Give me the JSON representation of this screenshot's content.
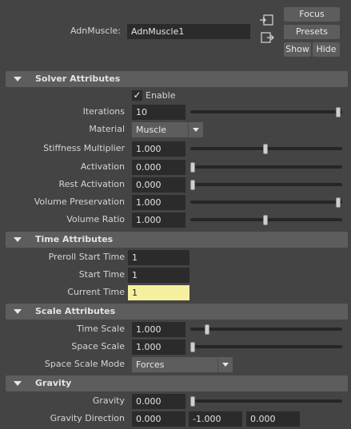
{
  "header": {
    "node_label": "AdnMuscle:",
    "node_value": "AdnMuscle1",
    "focus_label": "Focus",
    "presets_label": "Presets",
    "show_label": "Show",
    "hide_label": "Hide",
    "input_icon": "connection-in-icon",
    "output_icon": "connection-out-icon"
  },
  "solver": {
    "title": "Solver Attributes",
    "enable_label": "Enable",
    "enable_checked": true,
    "iterations": {
      "label": "Iterations",
      "value": "10",
      "slider": 1.0
    },
    "material": {
      "label": "Material",
      "value": "Muscle"
    },
    "stiffness": {
      "label": "Stiffness Multiplier",
      "value": "1.000",
      "slider": 0.5
    },
    "activation": {
      "label": "Activation",
      "value": "0.000",
      "slider": 0.0
    },
    "rest_activation": {
      "label": "Rest Activation",
      "value": "0.000",
      "slider": 0.0
    },
    "volume_preservation": {
      "label": "Volume Preservation",
      "value": "1.000",
      "slider": 1.0
    },
    "volume_ratio": {
      "label": "Volume Ratio",
      "value": "1.000",
      "slider": 0.5
    }
  },
  "time": {
    "title": "Time Attributes",
    "preroll": {
      "label": "Preroll Start Time",
      "value": "1"
    },
    "start": {
      "label": "Start Time",
      "value": "1"
    },
    "current": {
      "label": "Current Time",
      "value": "1"
    }
  },
  "scale": {
    "title": "Scale Attributes",
    "time_scale": {
      "label": "Time Scale",
      "value": "1.000",
      "slider": 0.1
    },
    "space_scale": {
      "label": "Space Scale",
      "value": "1.000",
      "slider": 0.0
    },
    "space_scale_mode": {
      "label": "Space Scale Mode",
      "value": "Forces"
    }
  },
  "gravity": {
    "title": "Gravity",
    "gravity": {
      "label": "Gravity",
      "value": "0.000",
      "slider": 0.0
    },
    "direction": {
      "label": "Gravity Direction",
      "x": "0.000",
      "y": "-1.000",
      "z": "0.000"
    }
  }
}
